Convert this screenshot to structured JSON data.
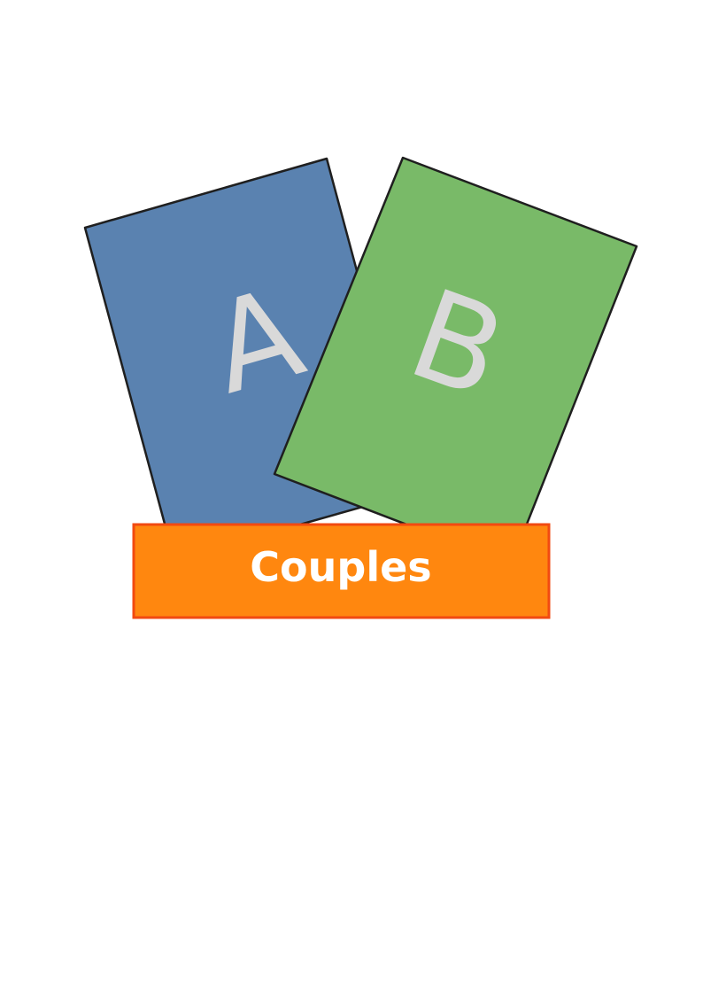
{
  "cards": [
    {
      "letter": "A",
      "fill": "#5a82b0",
      "stroke": "#1f1f1f",
      "text_color": "#d9d9d9"
    },
    {
      "letter": "B",
      "fill": "#79ba68",
      "stroke": "#1f1f1f",
      "text_color": "#d9d9d9"
    }
  ],
  "banner": {
    "label": "Couples",
    "fill": "#ff870f",
    "stroke": "#f24a10",
    "text_color": "#ffffff"
  }
}
